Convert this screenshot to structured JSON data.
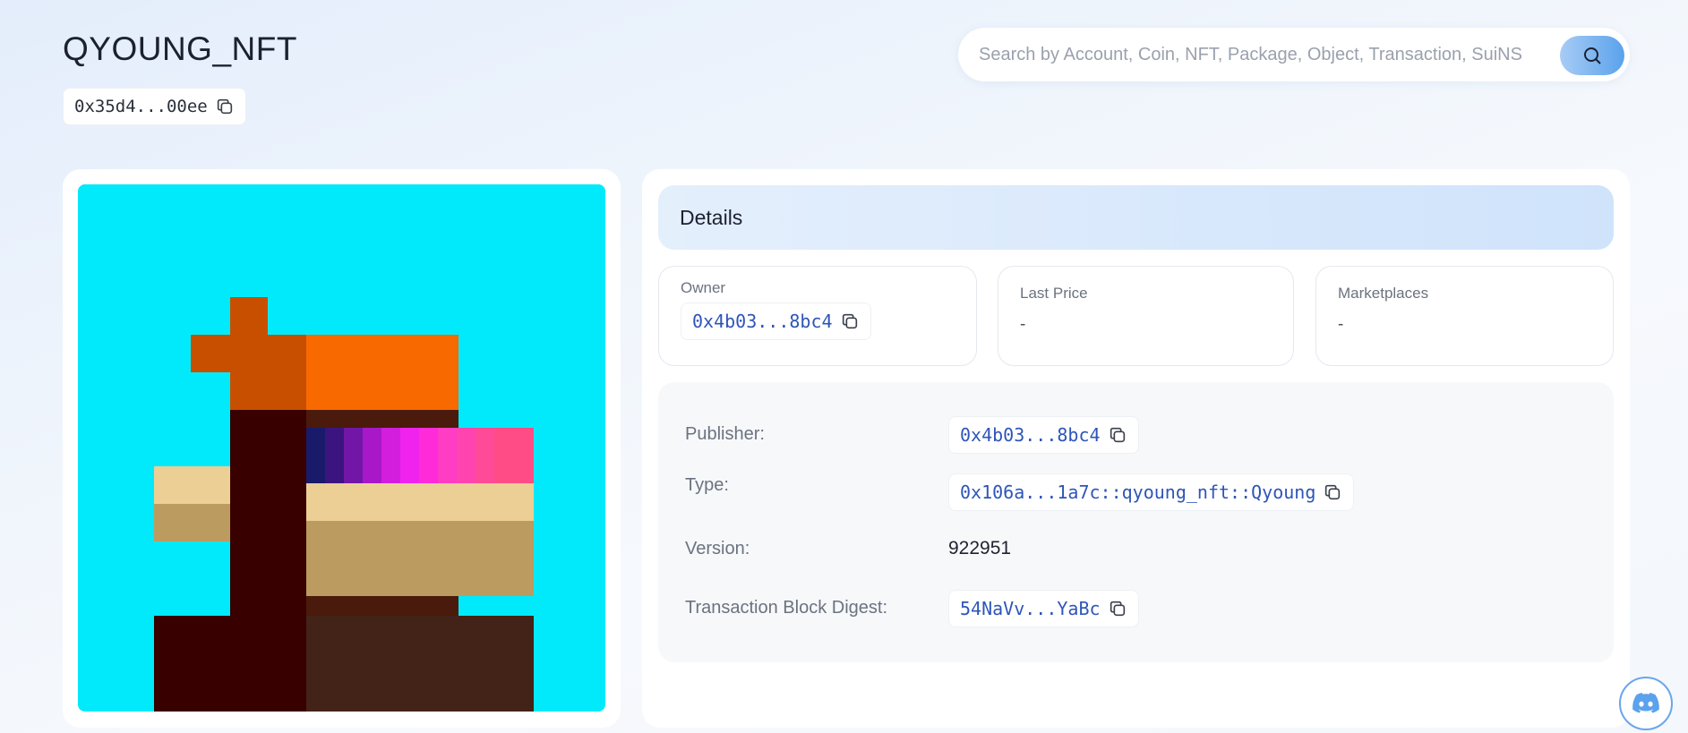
{
  "header": {
    "title": "QYOUNG_NFT",
    "object_id": "0x35d4...00ee"
  },
  "search": {
    "placeholder": "Search by Account, Coin, NFT, Package, Object, Transaction, SuiNS"
  },
  "details": {
    "heading": "Details",
    "owner": {
      "label": "Owner",
      "value": "0x4b03...8bc4"
    },
    "last_price": {
      "label": "Last Price",
      "value": "-"
    },
    "marketplaces": {
      "label": "Marketplaces",
      "value": "-"
    },
    "rows": {
      "publisher": {
        "label": "Publisher:",
        "value": "0x4b03...8bc4"
      },
      "type": {
        "label": "Type:",
        "value": "0x106a...1a7c::qyoung_nft::Qyoung"
      },
      "version": {
        "label": "Version:",
        "value": "922951"
      },
      "digest": {
        "label": "Transaction Block Digest:",
        "value": "54NaVv...YaBc"
      }
    }
  },
  "icons": {
    "copy": "copy-icon",
    "search": "search-icon",
    "discord": "discord-icon"
  },
  "colors": {
    "accent": "#5aa2ec",
    "link": "#2e55b8",
    "nft_background": "#00eafc"
  }
}
